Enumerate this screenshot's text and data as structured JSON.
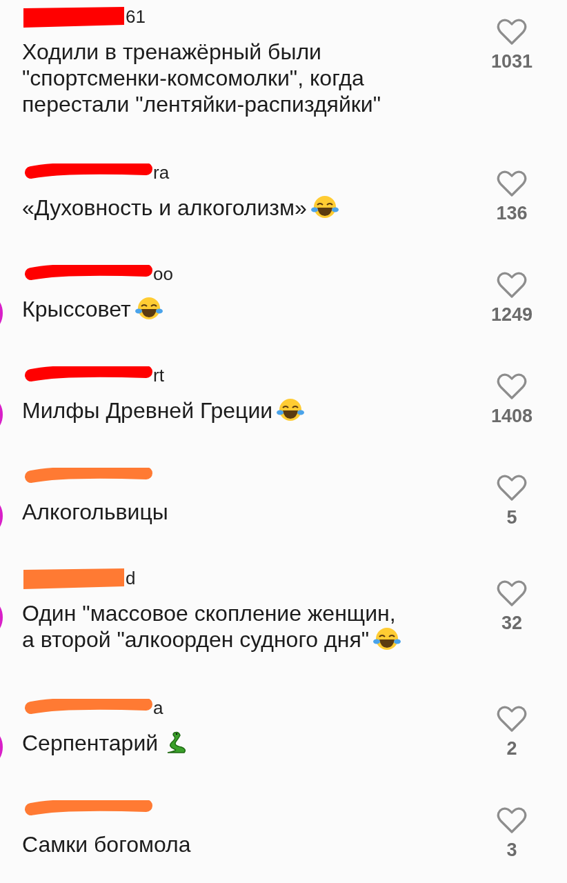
{
  "comments": [
    {
      "username": "61",
      "redaction": {
        "kind": "block",
        "color": "#ff0000"
      },
      "avatar_visible": false,
      "lines": [
        "Ходили в тренажёрный были",
        "\"спортсменки-комсомолки\", когда",
        "перестали \"лентяйки-распиздяйки\""
      ],
      "likes": "1031"
    },
    {
      "username": "ra",
      "redaction": {
        "kind": "stroke",
        "color": "#ff0000"
      },
      "avatar_visible": false,
      "lines": [
        "«Духовность и алкоголизм»"
      ],
      "emoji": {
        "kind": "laughing"
      },
      "likes": "136"
    },
    {
      "username": "oo",
      "redaction": {
        "kind": "stroke",
        "color": "#ff0000"
      },
      "avatar_visible": true,
      "lines": [
        "Крыссовет"
      ],
      "emoji": {
        "kind": "laughing"
      },
      "likes": "1249"
    },
    {
      "username": "rt",
      "redaction": {
        "kind": "stroke",
        "color": "#ff0000"
      },
      "avatar_visible": true,
      "lines": [
        "Милфы Древней Греции"
      ],
      "emoji": {
        "kind": "laughing"
      },
      "likes": "1408"
    },
    {
      "redaction": {
        "kind": "stroke",
        "color": "#ff7a33"
      },
      "avatar_visible": true,
      "lines": [
        "Алкогольвицы"
      ],
      "likes": "5"
    },
    {
      "username": "d",
      "redaction": {
        "kind": "block",
        "color": "#ff7a33"
      },
      "avatar_visible": true,
      "lines": [
        "Один \"массовое скопление женщин,",
        "а второй \"алкоорден судного дня\""
      ],
      "emoji": {
        "kind": "laughing"
      },
      "likes": "32"
    },
    {
      "username": "a",
      "redaction": {
        "kind": "stroke",
        "color": "#ff7a33"
      },
      "avatar_visible": true,
      "lines": [
        "Серпентарий"
      ],
      "emoji": {
        "kind": "snake"
      },
      "likes": "2"
    },
    {
      "redaction": {
        "kind": "stroke",
        "color": "#ff7a33"
      },
      "avatar_visible": false,
      "lines": [
        "Самки богомола"
      ],
      "likes": "3"
    }
  ]
}
